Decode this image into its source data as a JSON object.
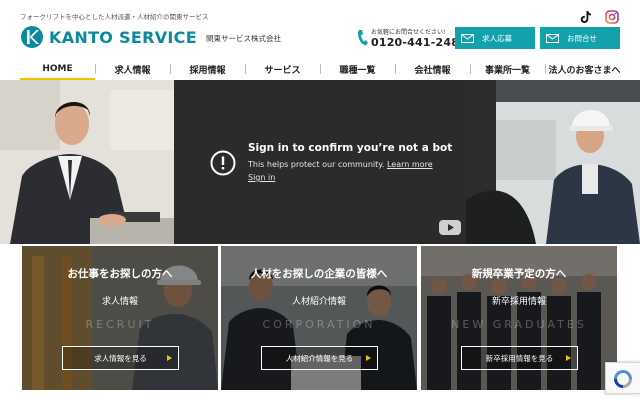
{
  "header": {
    "tagline": "フォークリフトを中心とした人材派遣・人材紹介の関東サービス",
    "logo_text": "KANTO SERVICE",
    "company_name": "関東サービス株式会社",
    "phone_label": "お気軽にお問合せください!",
    "phone_number": "0120-441-248",
    "apply_label": "求人応募",
    "contact_label": "お問合せ"
  },
  "nav": {
    "items": [
      {
        "label": "HOME",
        "active": true
      },
      {
        "label": "求人情報"
      },
      {
        "label": "採用情報"
      },
      {
        "label": "サービス"
      },
      {
        "label": "職種一覧"
      },
      {
        "label": "会社情報"
      },
      {
        "label": "事業所一覧"
      },
      {
        "label": "法人のお客さまへ"
      }
    ]
  },
  "video": {
    "title": "Sign in to confirm you’re not a bot",
    "text": "This helps protect our community.",
    "learn_more": "Learn more",
    "sign_in": "Sign in"
  },
  "panels": [
    {
      "title": "お仕事をお探しの方へ",
      "subtitle": "求人情報",
      "english": "RECRUIT",
      "button": "求人情報を見る"
    },
    {
      "title": "人材をお探しの企業の皆様へ",
      "subtitle": "人材紹介情報",
      "english": "CORPORATION",
      "button": "人材紹介情報を見る"
    },
    {
      "title": "新規卒業予定の方へ",
      "subtitle": "新卒採用情報",
      "english": "NEW GRADUATES",
      "button": "新卒採用情報を見る"
    }
  ],
  "colors": {
    "brand": "#0a8a9e",
    "button": "#13a2ac",
    "accent": "#f2c200",
    "video_bg": "#2b2b2b"
  },
  "icons": {
    "logo": "kanto-logo-mark",
    "phone": "phone-icon",
    "mail": "mail-icon",
    "tiktok": "tiktok-icon",
    "instagram": "instagram-icon",
    "alert": "exclamation-circle-icon",
    "youtube": "youtube-icon",
    "recaptcha": "recaptcha-icon"
  }
}
